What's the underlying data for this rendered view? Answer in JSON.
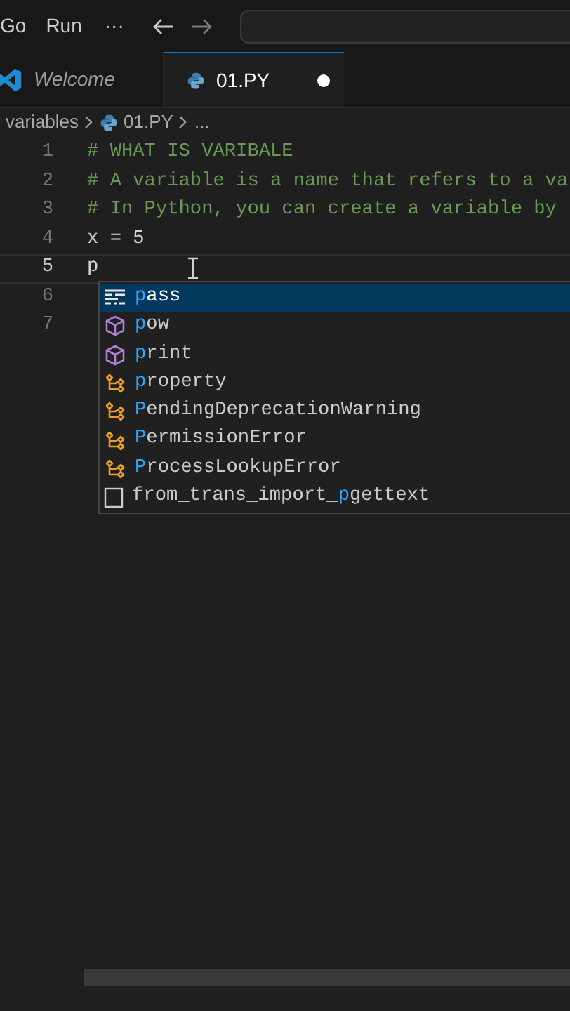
{
  "menu": [
    "Go",
    "Run"
  ],
  "more": "···",
  "tabs": [
    {
      "label": "Welcome",
      "kind": "welcome",
      "selected": false,
      "dirty": false
    },
    {
      "label": "01.PY",
      "kind": "python",
      "selected": true,
      "dirty": true
    }
  ],
  "breadcrumb": [
    {
      "label": "variables",
      "kind": "folder"
    },
    {
      "label": "01.PY",
      "kind": "python"
    },
    {
      "label": "...",
      "kind": "symbol"
    }
  ],
  "lines": [
    {
      "number": "1",
      "text": "# WHAT IS VARIBALE",
      "kind": "comment",
      "current": false
    },
    {
      "number": "2",
      "text": "# A variable is a name that refers to a va",
      "kind": "comment",
      "current": false
    },
    {
      "number": "3",
      "text": "# In Python, you can create a variable by",
      "kind": "comment",
      "current": false
    },
    {
      "number": "4",
      "text": "x = 5",
      "kind": "code",
      "current": false
    },
    {
      "number": "5",
      "text": "p",
      "kind": "code",
      "current": true
    },
    {
      "number": "6",
      "current": false
    },
    {
      "number": "7",
      "current": false
    }
  ],
  "suggestions": [
    {
      "kind": "keyword",
      "match": "p",
      "after": "ass",
      "selected": true
    },
    {
      "kind": "function",
      "match": "p",
      "after": "ow",
      "selected": false
    },
    {
      "kind": "function",
      "match": "p",
      "after": "rint",
      "selected": false
    },
    {
      "kind": "class",
      "match": "p",
      "after": "roperty",
      "selected": false
    },
    {
      "kind": "class",
      "match": "P",
      "after": "endingDeprecationWarning",
      "selected": false
    },
    {
      "kind": "class",
      "match": "P",
      "after": "ermissionError",
      "selected": false
    },
    {
      "kind": "class",
      "match": "P",
      "after": "rocessLookupError",
      "selected": false
    },
    {
      "kind": "text",
      "before": "from_trans_import_",
      "match": "p",
      "after": "gettext",
      "selected": false
    }
  ]
}
